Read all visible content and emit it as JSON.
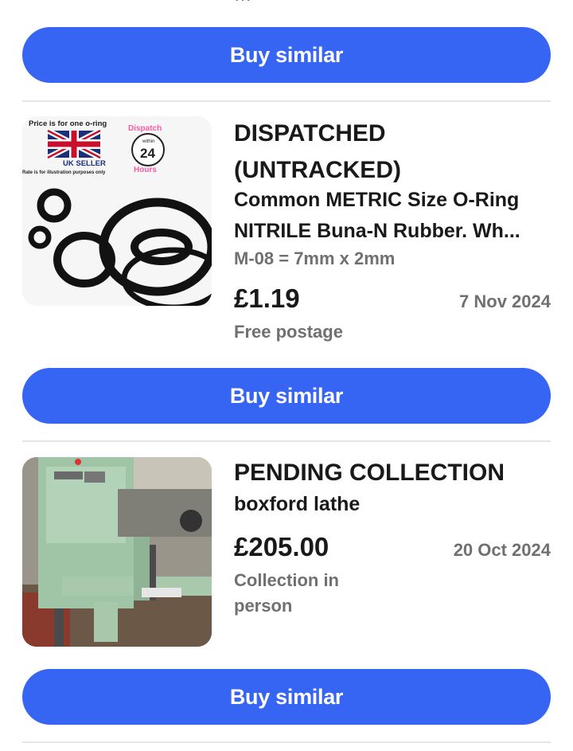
{
  "buttons": {
    "buy_similar": "Buy similar"
  },
  "items": [
    {
      "status": "DISPATCHED (UNTRACKED)",
      "title_line1": "Common METRIC Size O-Ring",
      "title_line2": "NITRILE Buna-N Rubber. Wh...",
      "variant": "M-08 = 7mm x 2mm",
      "price": "£1.19",
      "date": "7 Nov 2024",
      "postage": "Free postage",
      "image": {
        "caption_top": "Price is for one o-ring",
        "seller": "UK SELLER",
        "disclaimer": "Rate is for illustration purposes only",
        "dispatch": "Dispatch",
        "within": "within",
        "hours_number": "24",
        "hours": "Hours"
      }
    },
    {
      "status": "PENDING COLLECTION",
      "title": "boxford lathe",
      "price": "£205.00",
      "date": "20 Oct 2024",
      "postage": "Collection in person"
    }
  ],
  "colors": {
    "button": "#3665f3",
    "muted": "#707070",
    "text": "#191919"
  }
}
